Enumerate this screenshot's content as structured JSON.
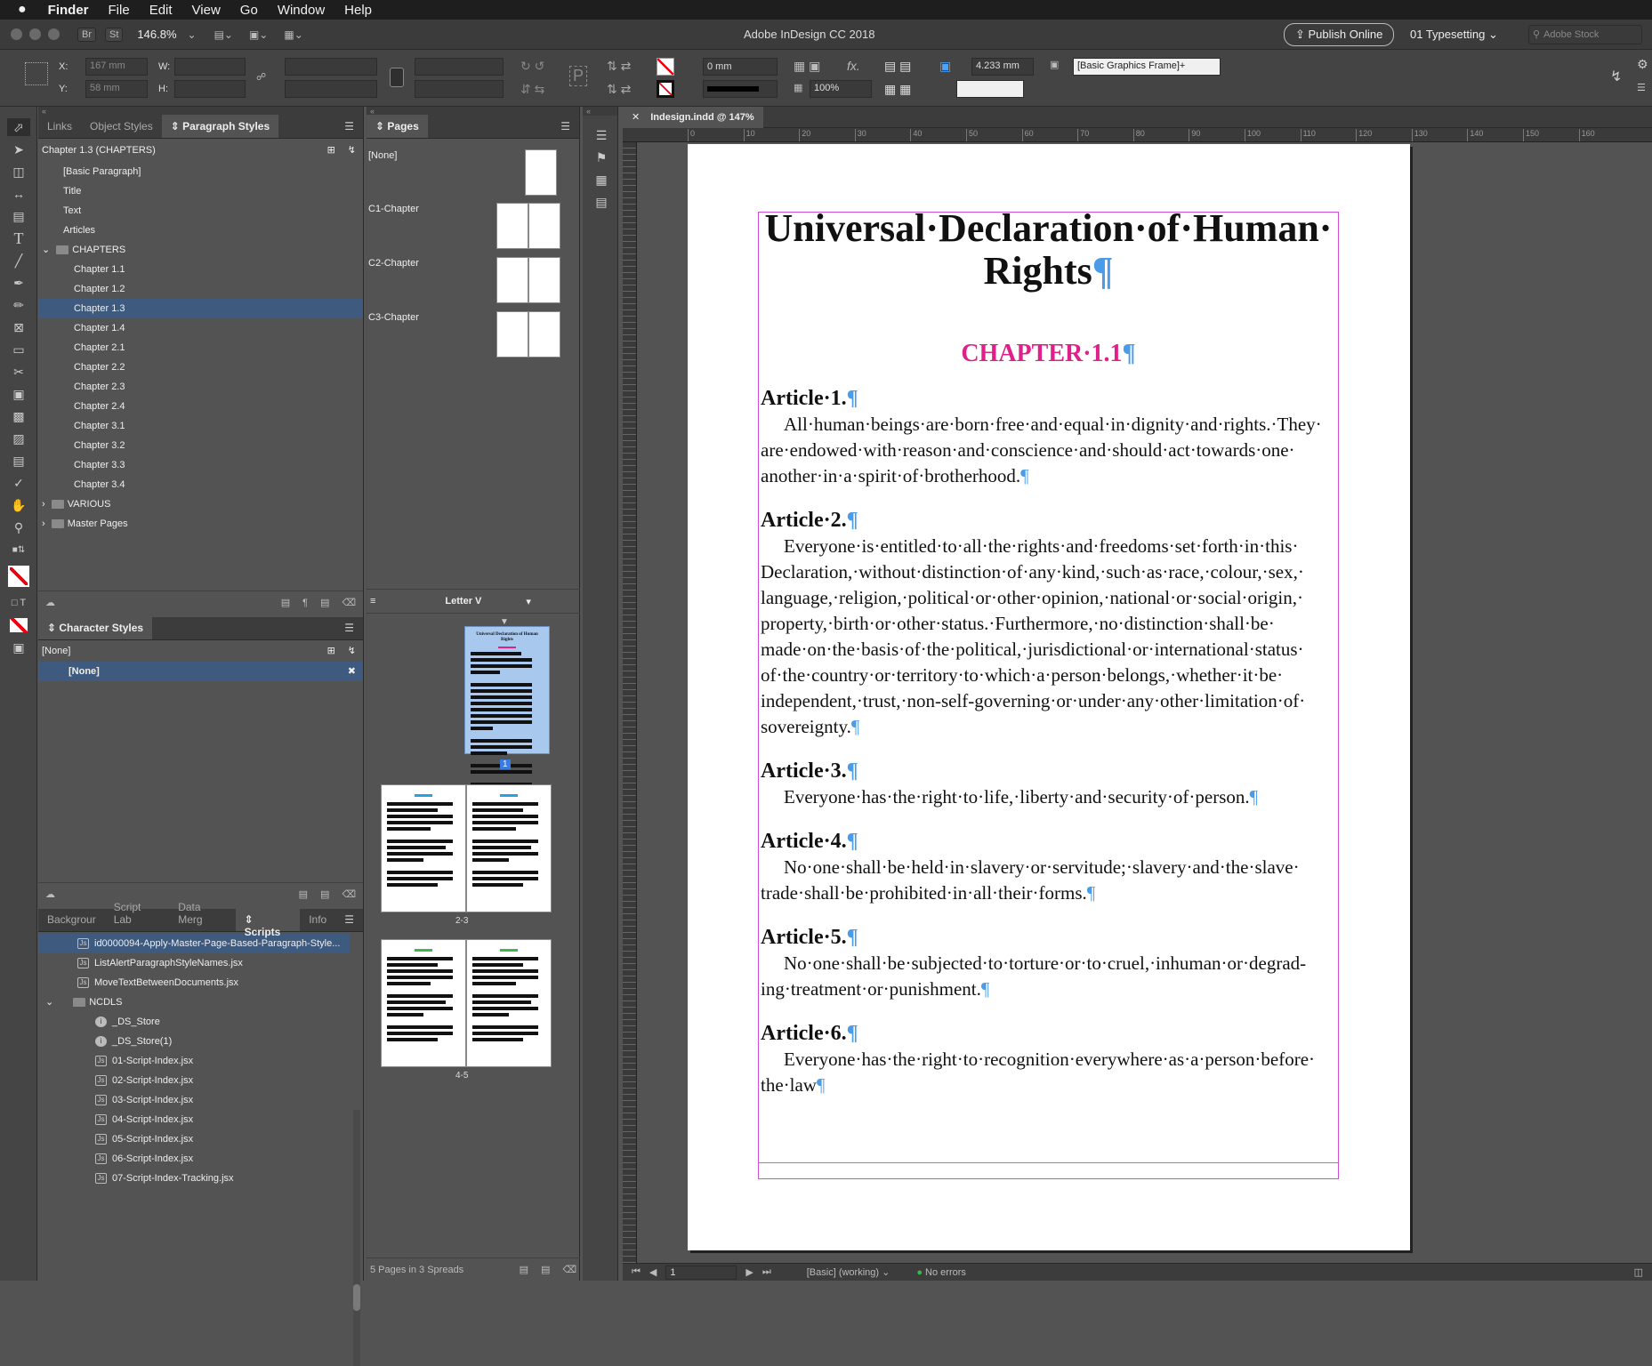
{
  "menubar": {
    "apple": "",
    "items": [
      "Finder",
      "File",
      "Edit",
      "View",
      "Go",
      "Window",
      "Help"
    ]
  },
  "appbar": {
    "br": "Br",
    "st": "St",
    "zoom": "146.8%",
    "title": "Adobe InDesign CC 2018",
    "publish": "Publish Online",
    "workspace": "01 Typesetting",
    "stock_placeholder": "Adobe Stock"
  },
  "control": {
    "x_label": "X:",
    "x_value": "167 mm",
    "y_label": "Y:",
    "y_value": "58 mm",
    "w_label": "W:",
    "h_label": "H:",
    "stroke_weight": "0 mm",
    "opacity": "100%",
    "fx": "fx.",
    "gap": "4.233 mm",
    "object_style": "[Basic Graphics Frame]+"
  },
  "styles_panel": {
    "tabs": [
      "Links",
      "Object Styles",
      "Paragraph Styles"
    ],
    "current": "Chapter 1.3 (CHAPTERS)",
    "items": [
      {
        "label": "[Basic Paragraph]",
        "level": 1,
        "type": "style"
      },
      {
        "label": "Title",
        "level": 1,
        "type": "style"
      },
      {
        "label": "Text",
        "level": 1,
        "type": "style"
      },
      {
        "label": "Articles",
        "level": 1,
        "type": "style"
      },
      {
        "label": "CHAPTERS",
        "level": 0,
        "type": "folder-open"
      },
      {
        "label": "Chapter 1.1",
        "level": 2,
        "type": "style"
      },
      {
        "label": "Chapter 1.2",
        "level": 2,
        "type": "style"
      },
      {
        "label": "Chapter 1.3",
        "level": 2,
        "type": "style",
        "selected": true
      },
      {
        "label": "Chapter 1.4",
        "level": 2,
        "type": "style"
      },
      {
        "label": "Chapter 2.1",
        "level": 2,
        "type": "style"
      },
      {
        "label": "Chapter 2.2",
        "level": 2,
        "type": "style"
      },
      {
        "label": "Chapter 2.3",
        "level": 2,
        "type": "style"
      },
      {
        "label": "Chapter 2.4",
        "level": 2,
        "type": "style"
      },
      {
        "label": "Chapter 3.1",
        "level": 2,
        "type": "style"
      },
      {
        "label": "Chapter 3.2",
        "level": 2,
        "type": "style"
      },
      {
        "label": "Chapter 3.3",
        "level": 2,
        "type": "style"
      },
      {
        "label": "Chapter 3.4",
        "level": 2,
        "type": "style"
      },
      {
        "label": "VARIOUS",
        "level": 0,
        "type": "folder"
      },
      {
        "label": "Master Pages",
        "level": 0,
        "type": "folder"
      }
    ]
  },
  "char_panel": {
    "title": "Character Styles",
    "current": "[None]",
    "items": [
      {
        "label": "[None]",
        "selected": true
      }
    ]
  },
  "scripts_panel": {
    "tabs": [
      "Backgrour",
      "Script Lab",
      "Data Merg",
      "Scripts",
      "Info"
    ],
    "items": [
      {
        "label": "id0000094-Apply-Master-Page-Based-Paragraph-Style...",
        "level": 1,
        "type": "script",
        "selected": true
      },
      {
        "label": "ListAlertParagraphStyleNames.jsx",
        "level": 1,
        "type": "script"
      },
      {
        "label": "MoveTextBetweenDocuments.jsx",
        "level": 1,
        "type": "script"
      },
      {
        "label": "NCDLS",
        "level": 1,
        "type": "folder-open"
      },
      {
        "label": "_DS_Store",
        "level": 2,
        "type": "info"
      },
      {
        "label": "_DS_Store(1)",
        "level": 2,
        "type": "info"
      },
      {
        "label": "01-Script-Index.jsx",
        "level": 2,
        "type": "script"
      },
      {
        "label": "02-Script-Index.jsx",
        "level": 2,
        "type": "script"
      },
      {
        "label": "03-Script-Index.jsx",
        "level": 2,
        "type": "script"
      },
      {
        "label": "04-Script-Index.jsx",
        "level": 2,
        "type": "script"
      },
      {
        "label": "05-Script-Index.jsx",
        "level": 2,
        "type": "script"
      },
      {
        "label": "06-Script-Index.jsx",
        "level": 2,
        "type": "script"
      },
      {
        "label": "07-Script-Index-Tracking.jsx",
        "level": 2,
        "type": "script"
      }
    ]
  },
  "pages_panel": {
    "title": "Pages",
    "masters": [
      "[None]",
      "C1-Chapter",
      "C2-Chapter",
      "C3-Chapter"
    ],
    "page_size": "Letter V",
    "page1": "1",
    "spread2": "2-3",
    "spread3": "4-5",
    "thumb_title": "Universal Declaration of Human Rights",
    "footer": "5 Pages in 3 Spreads"
  },
  "document": {
    "tab": "Indesign.indd @ 147%",
    "ruler": [
      "0",
      "10",
      "20",
      "30",
      "40",
      "50",
      "60",
      "70",
      "80",
      "90",
      "100",
      "110",
      "120",
      "130",
      "140",
      "150",
      "160"
    ],
    "title_line1": "Universal·Declaration·of·Human·",
    "title_line2": "Rights",
    "chapter": "CHAPTER·1.1",
    "pilcrow": "¶",
    "articles": [
      {
        "heading": "Article·1.",
        "text": "All·human·beings·are·born·free·and·equal·in·dignity·and·rights.·They· are·endowed·with·reason·and·conscience·and·should·act·towards·one· another·in·a·spirit·of·brotherhood."
      },
      {
        "heading": "Article·2.",
        "text": "Everyone·is·entitled·to·all·the·rights·and·freedoms·set·forth·in·this· Declaration,·without·distinction·of·any·kind,·such·as·race,·colour,·sex,· language,·religion,·political·or·other·opinion,·national·or·social·origin,· property,·birth·or·other·status.·Furthermore,·no·distinction·shall·be· made·on·the·basis·of·the·political,·jurisdictional·or·international·status· of·the·country·or·territory·to·which·a·person·belongs,·whether·it·be· independent,·trust,·non-self-governing·or·under·any·other·limitation·of· sovereignty."
      },
      {
        "heading": "Article·3.",
        "text": "Everyone·has·the·right·to·life,·liberty·and·security·of·person."
      },
      {
        "heading": "Article·4.",
        "text": "No·one·shall·be·held·in·slavery·or·servitude;·slavery·and·the·slave· trade·shall·be·prohibited·in·all·their·forms."
      },
      {
        "heading": "Article·5.",
        "text": "No·one·shall·be·subjected·to·torture·or·to·cruel,·inhuman·or·degrad- ing·treatment·or·punishment."
      },
      {
        "heading": "Article·6.",
        "text": "Everyone·has·the·right·to·recognition·everywhere·as·a·person·before· the·law"
      }
    ]
  },
  "statusbar": {
    "page": "1",
    "profile": "[Basic] (working)",
    "errors": "No errors"
  },
  "colors": {
    "chapter": "#e0208a",
    "frame": "#d44dd8",
    "pilcrow": "#4a9ce8",
    "selection": "#3e5a7e",
    "thumb_highlight": "#a9c8ee"
  }
}
